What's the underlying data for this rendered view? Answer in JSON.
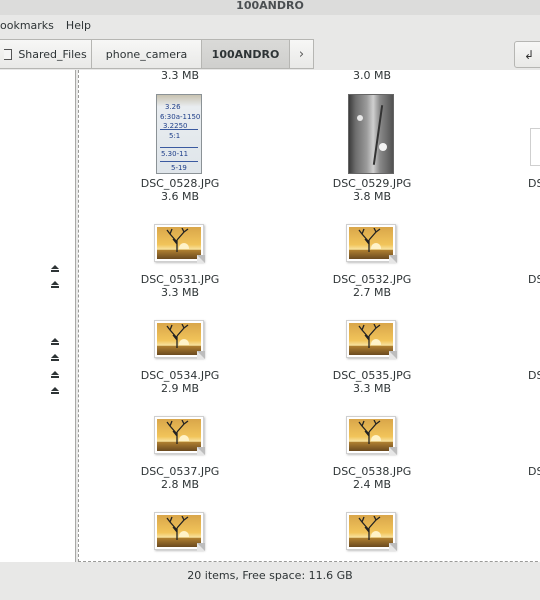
{
  "window": {
    "title": "100ANDRO"
  },
  "menu": {
    "items": [
      "ookmarks",
      "Help"
    ]
  },
  "pathbar": {
    "crumbs": [
      "Shared_Files",
      "phone_camera",
      "100ANDRO"
    ],
    "next_arrow": "›"
  },
  "toolbar": {
    "right_button": "↲"
  },
  "files": {
    "top_sizes": [
      "3.3 MB",
      "3.0 MB"
    ],
    "items": [
      {
        "name": "DSC_0528.JPG",
        "size": "3.6 MB"
      },
      {
        "name": "DSC_0529.JPG",
        "size": "3.8 MB"
      },
      {
        "name": "DSC_0531.JPG",
        "size": "3.3 MB"
      },
      {
        "name": "DSC_0532.JPG",
        "size": "2.7 MB"
      },
      {
        "name": "DSC_0534.JPG",
        "size": "2.9 MB"
      },
      {
        "name": "DSC_0535.JPG",
        "size": "3.3 MB"
      },
      {
        "name": "DSC_0537.JPG",
        "size": "2.8 MB"
      },
      {
        "name": "DSC_0538.JPG",
        "size": "2.4 MB"
      }
    ],
    "partial_column": [
      "DS",
      "DS",
      "DS",
      "DS"
    ]
  },
  "note_text": [
    "3.26",
    "6:30a-1150",
    "3.2250",
    "5:1",
    "5.30-11",
    "5-19"
  ],
  "status": {
    "text": "20 items, Free space: 11.6 GB"
  },
  "icons": {
    "eject": "eject-icon",
    "folder": "folder-icon",
    "image": "image-file-icon"
  }
}
